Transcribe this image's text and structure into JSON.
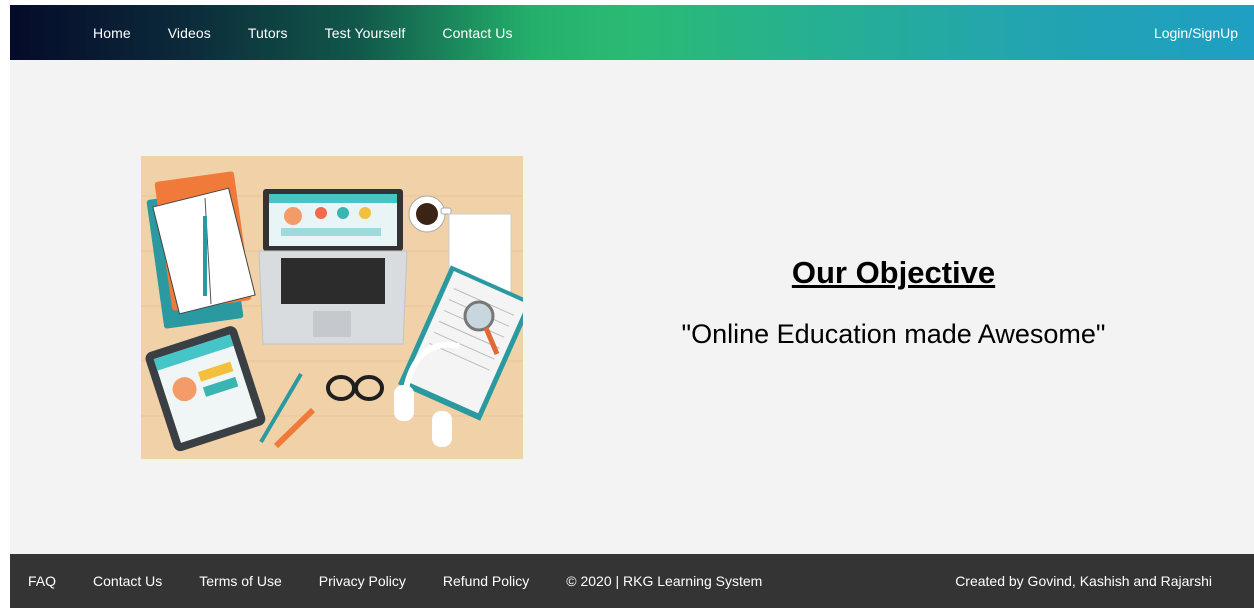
{
  "nav": {
    "links": [
      "Home",
      "Videos",
      "Tutors",
      "Test Yourself",
      "Contact Us"
    ],
    "login": "Login/SignUp"
  },
  "hero": {
    "title": "Our Objective",
    "subtitle": "\"Online Education made Awesome\""
  },
  "footer": {
    "links": [
      "FAQ",
      "Contact Us",
      "Terms of Use",
      "Privacy Policy",
      "Refund Policy"
    ],
    "copyright": "© 2020 | RKG Learning System",
    "credits": "Created by Govind, Kashish and Rajarshi"
  },
  "colors": {
    "nav_start": "#050b2a",
    "nav_mid": "#2bba74",
    "nav_end": "#1f9fc3",
    "page_bg": "#f3f3f3",
    "footer_bg": "#343434"
  }
}
